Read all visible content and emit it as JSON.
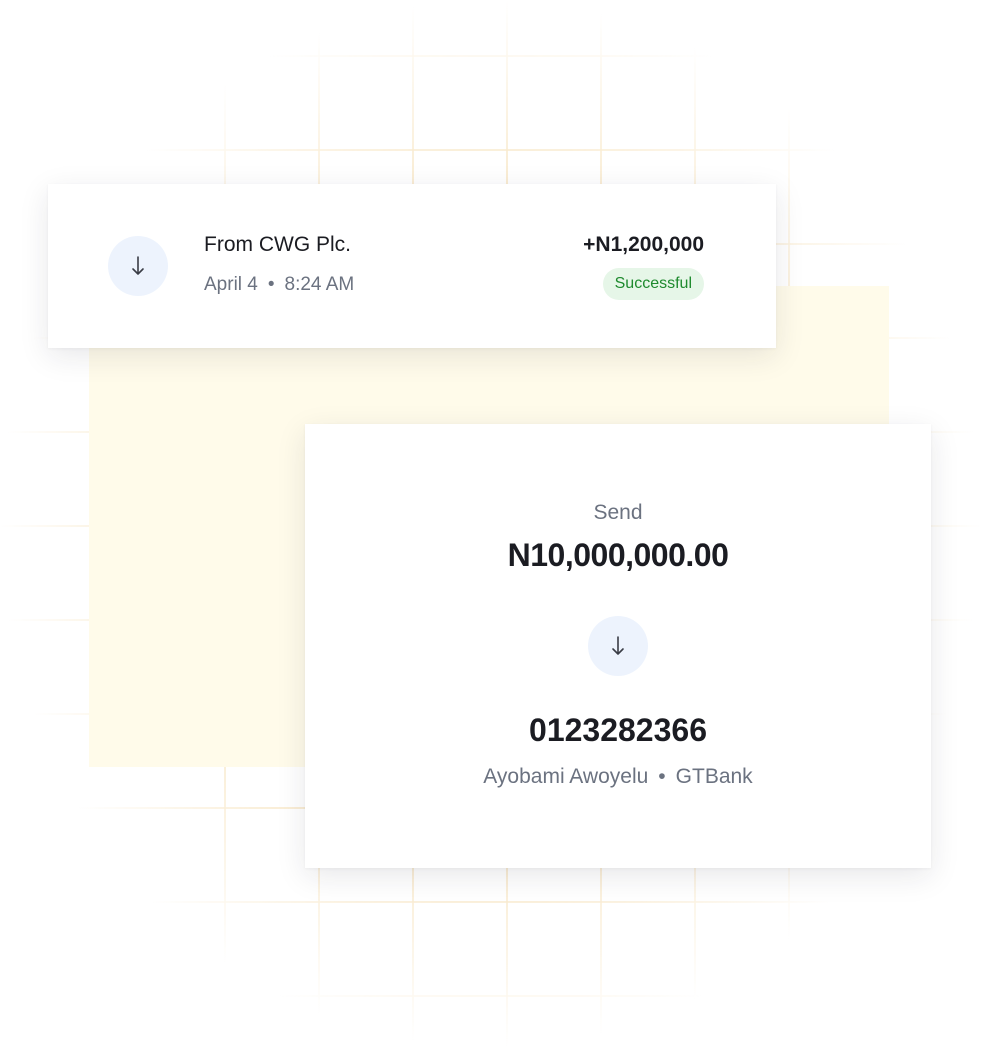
{
  "transaction": {
    "icon": "arrow-down-icon",
    "title": "From CWG Plc.",
    "date": "April 4",
    "separator": "•",
    "time": "8:24 AM",
    "amount": "+N1,200,000",
    "status": "Successful"
  },
  "send": {
    "label": "Send",
    "amount": "N10,000,000.00",
    "icon": "arrow-down-icon",
    "account_number": "0123282366",
    "account_name": "Ayobami Awoyelu",
    "separator": "•",
    "bank": "GTBank"
  },
  "colors": {
    "accent_circle": "#edf3fd",
    "success_bg": "#e6f6e8",
    "success_text": "#1e8a2e",
    "panel_yellow": "#fffbea",
    "grid_line": "#f6dfb4"
  }
}
